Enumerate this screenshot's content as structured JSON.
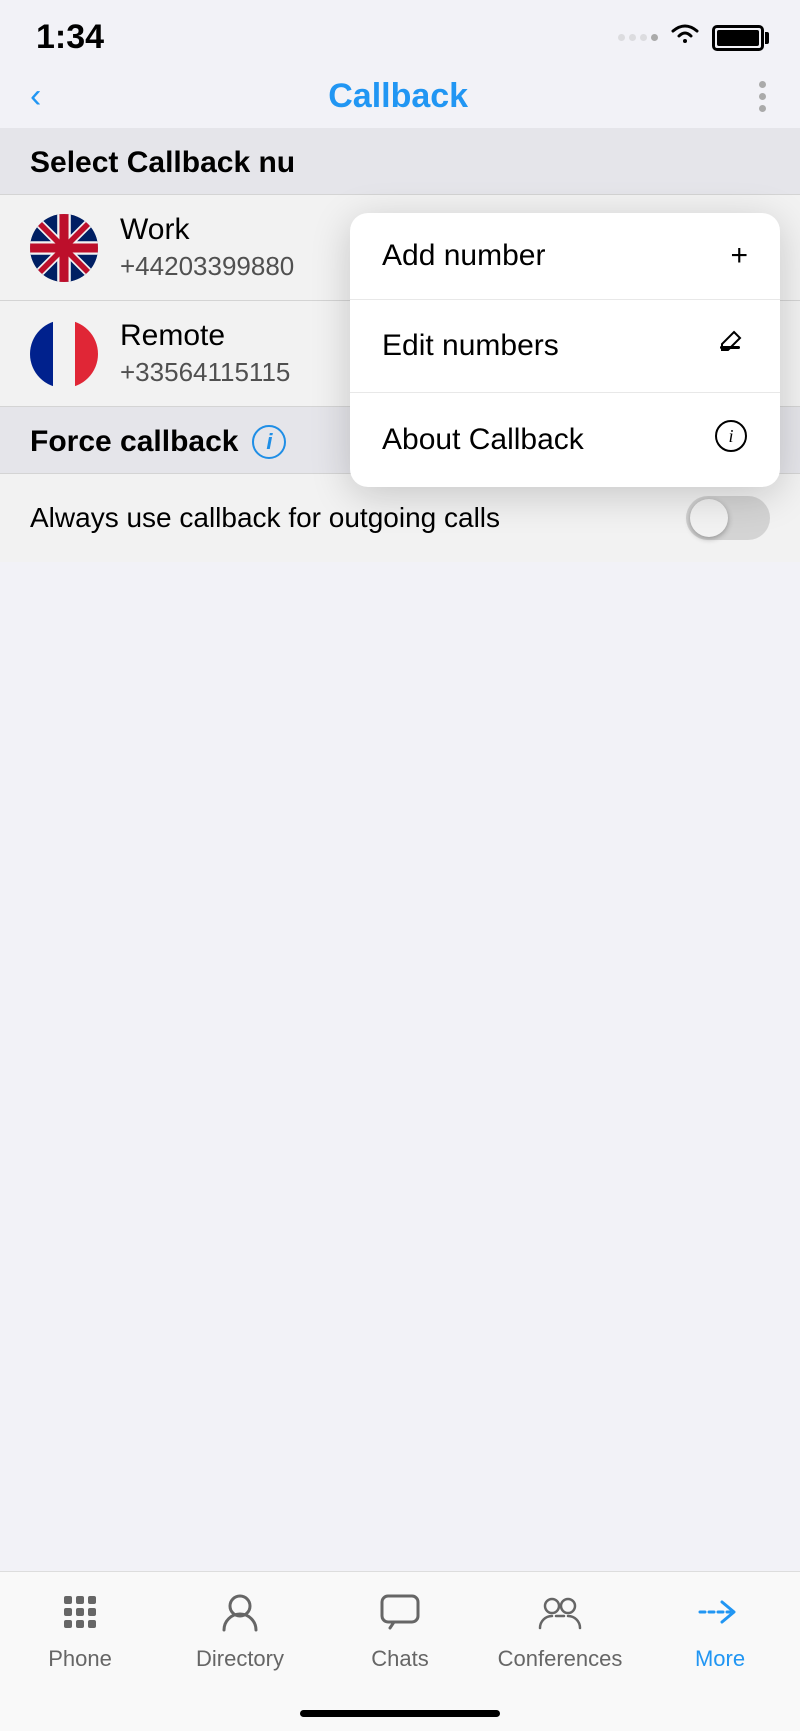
{
  "statusBar": {
    "time": "1:34"
  },
  "navBar": {
    "backLabel": "‹",
    "title": "Callback",
    "moreLabel": "⋮"
  },
  "selectSection": {
    "header": "Select Callback nu"
  },
  "numbers": [
    {
      "name": "Work",
      "number": "+44203399880",
      "flag": "uk",
      "selected": true
    },
    {
      "name": "Remote",
      "number": "+33564115115",
      "flag": "fr",
      "selected": false
    }
  ],
  "forceCallback": {
    "title": "Force callback",
    "infoIcon": "i",
    "toggleLabel": "Always use callback for outgoing calls",
    "toggleState": false
  },
  "dropdown": {
    "items": [
      {
        "label": "Add number",
        "icon": "+"
      },
      {
        "label": "Edit numbers",
        "icon": "✎"
      },
      {
        "label": "About Callback",
        "icon": "ⓘ"
      }
    ]
  },
  "tabBar": {
    "items": [
      {
        "label": "Phone",
        "icon": "phone",
        "active": false
      },
      {
        "label": "Directory",
        "icon": "directory",
        "active": false
      },
      {
        "label": "Chats",
        "icon": "chats",
        "active": false
      },
      {
        "label": "Conferences",
        "icon": "conferences",
        "active": false
      },
      {
        "label": "More",
        "icon": "more",
        "active": true
      }
    ]
  }
}
